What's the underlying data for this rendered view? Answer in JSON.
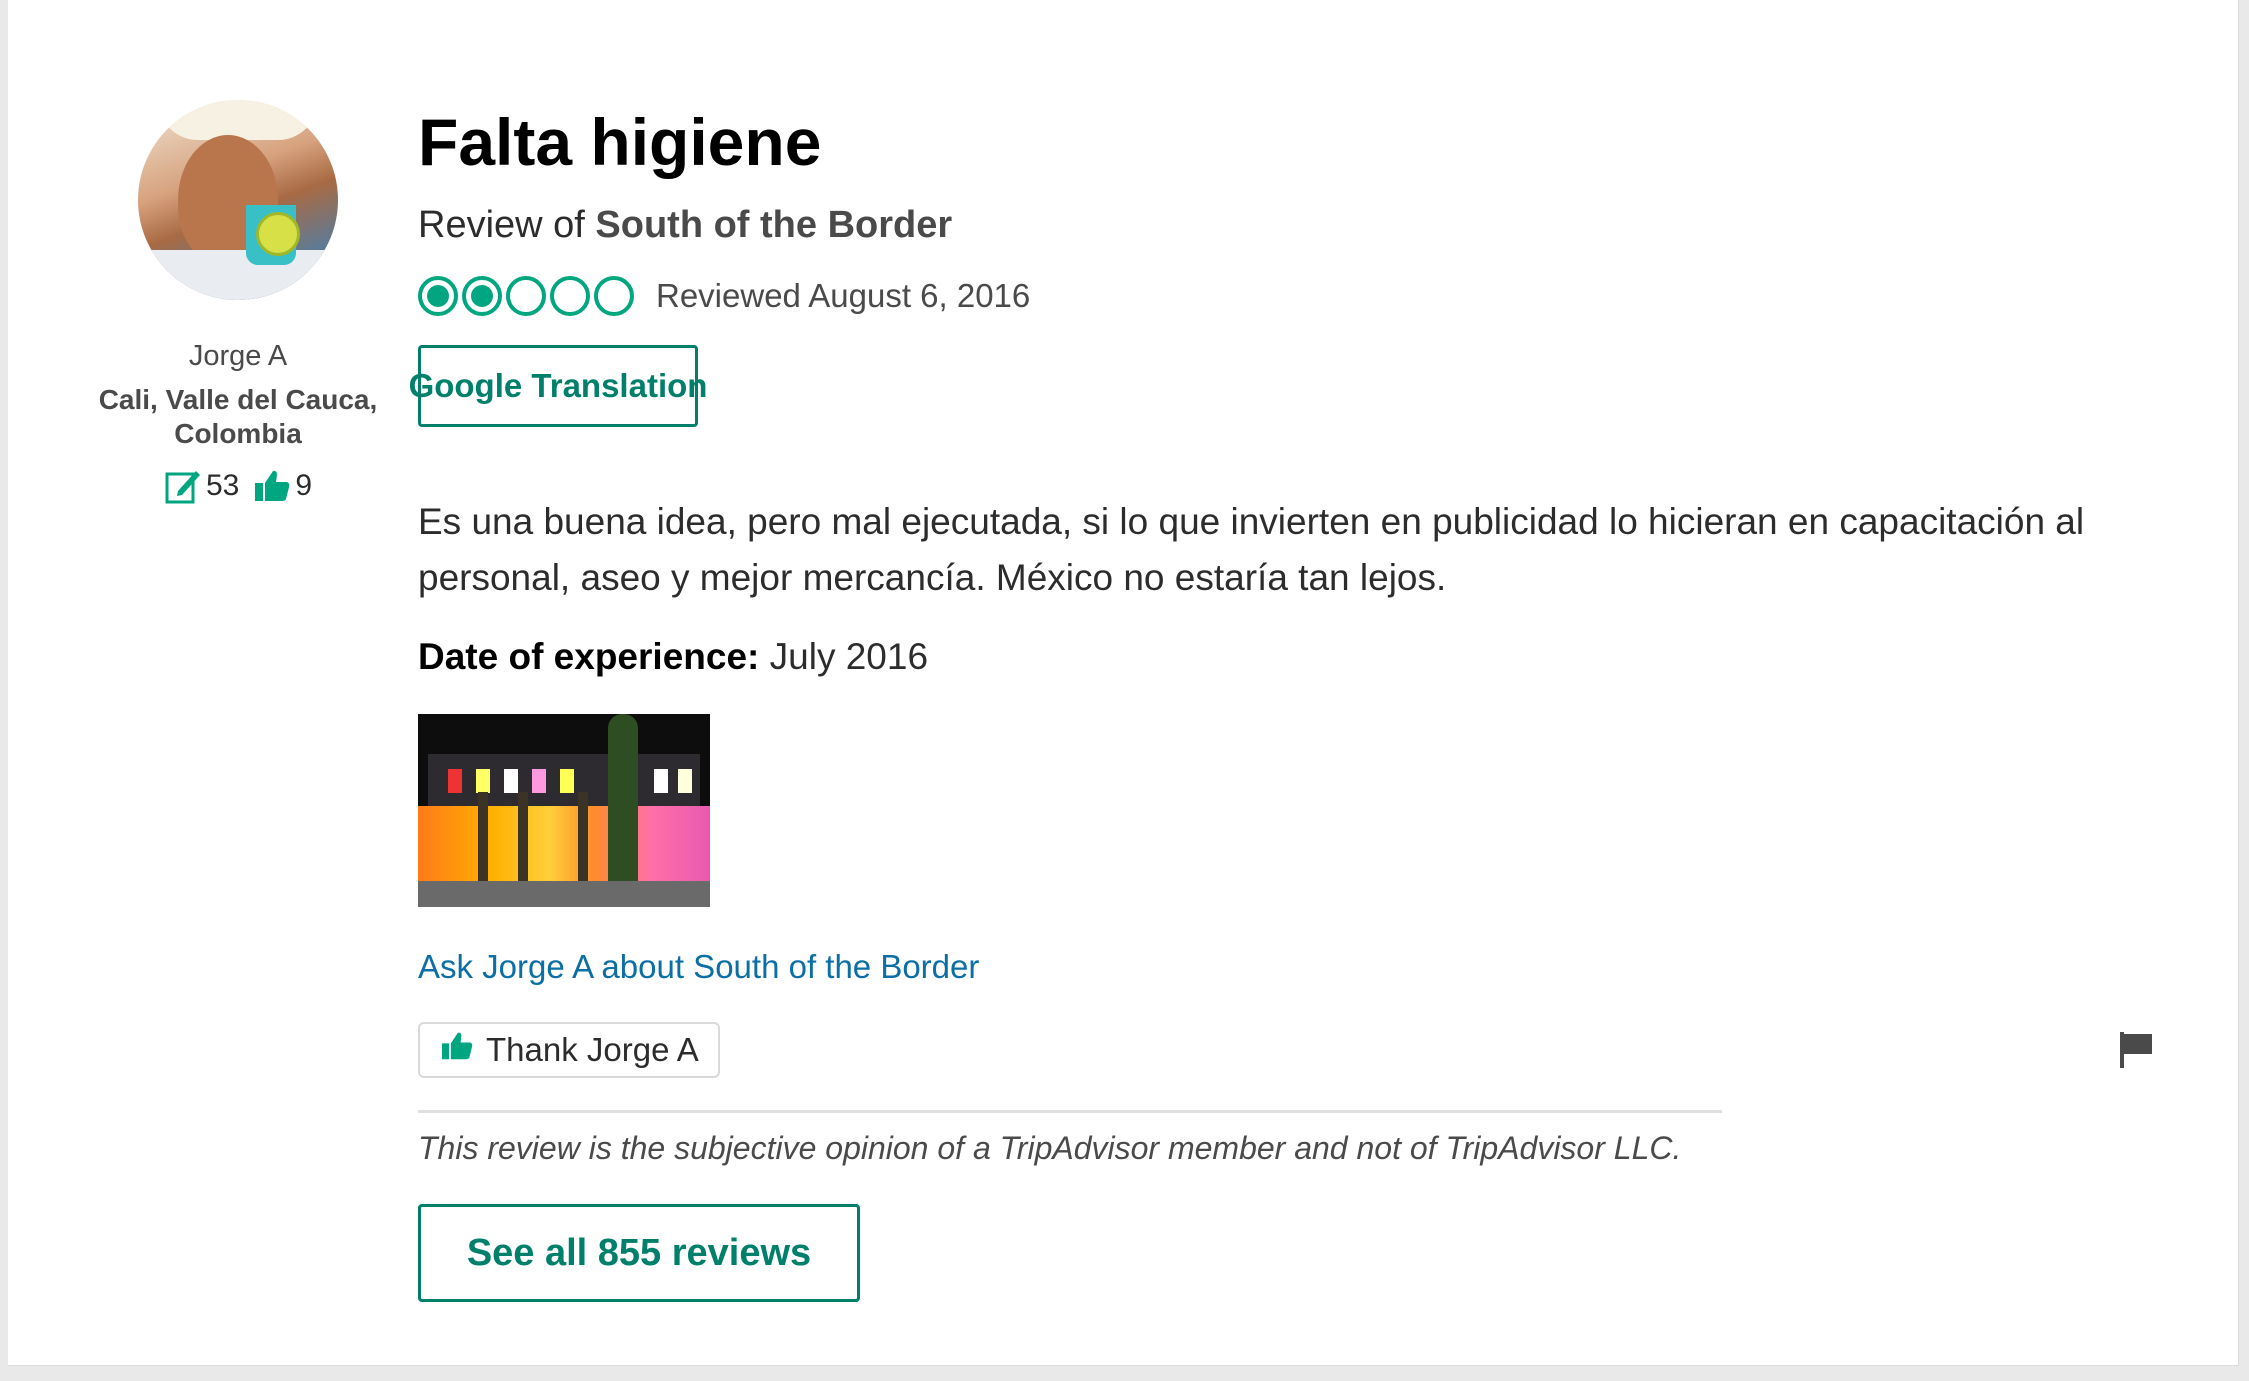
{
  "member": {
    "username": "Jorge A",
    "location": "Cali, Valle del Cauca, Colombia",
    "reviews_count": "53",
    "helpful_votes": "9"
  },
  "review": {
    "title": "Falta higiene",
    "review_of_prefix": "Review of",
    "place_name": "South of the Border",
    "rating": 2,
    "rating_max": 5,
    "reviewed_date": "Reviewed August 6, 2016",
    "translation_button": "Google Translation",
    "text": "Es una buena idea, pero mal ejecutada, si lo que invierten en publicidad lo hicieran en capacitación al personal, aseo y mejor mercancía. México no estaría tan lejos.",
    "date_of_experience_label": "Date of experience:",
    "date_of_experience_value": "July 2016",
    "ask_link": "Ask Jorge A about South of the Border",
    "thank_button": "Thank Jorge A",
    "disclaimer": "This review is the subjective opinion of a TripAdvisor member and not of TripAdvisor LLC.",
    "see_all_button": "See all 855 reviews"
  },
  "colors": {
    "brand_green": "#00806a",
    "bubble_green": "#00a680",
    "link_blue": "#0b6fa6"
  },
  "icons": {
    "reviews": "pencil-square-icon",
    "helpful": "thumbs-up-icon",
    "flag": "flag-icon"
  }
}
